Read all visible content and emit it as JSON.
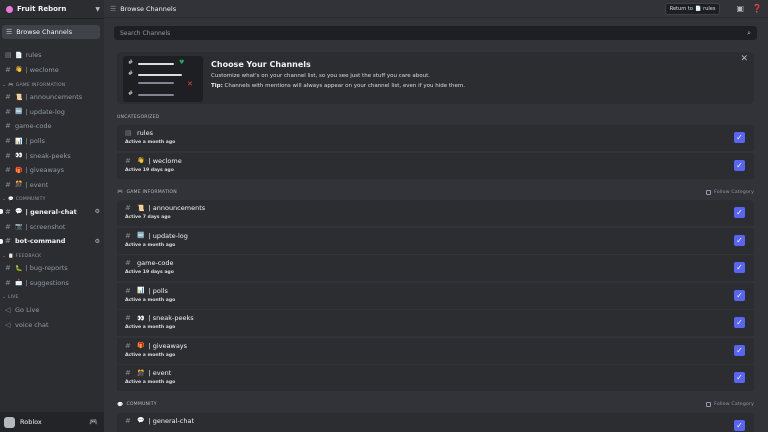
{
  "server": {
    "name": "Fruit Reborn"
  },
  "sidebar": {
    "browse_label": "Browse Channels",
    "channels": [
      {
        "label": "rules",
        "emoji": "📄",
        "type": "rules",
        "y": 0
      },
      {
        "label": "| weclome",
        "emoji": "👋",
        "type": "text",
        "y": 1
      }
    ],
    "categories": [
      {
        "title": "GAME INFORMATION",
        "emoji": "🎮",
        "channels": [
          {
            "label": "| announcements",
            "emoji": "📜"
          },
          {
            "label": "| update-log",
            "emoji": "🆕"
          },
          {
            "label": "game-code",
            "emoji": ""
          },
          {
            "label": "| polls",
            "emoji": "📊"
          },
          {
            "label": "| sneak-peeks",
            "emoji": "👀"
          },
          {
            "label": "| giveaways",
            "emoji": "🎁"
          },
          {
            "label": "| event",
            "emoji": "🎊"
          }
        ]
      },
      {
        "title": "COMMUNITY",
        "emoji": "💬",
        "channels": [
          {
            "label": "| general-chat",
            "emoji": "💬",
            "bold": true
          },
          {
            "label": "| screenshot",
            "emoji": "📷"
          },
          {
            "label": "bot-command",
            "emoji": "",
            "bold": true
          }
        ]
      },
      {
        "title": "FEEDBACK",
        "emoji": "📋",
        "channels": [
          {
            "label": "| bug-reports",
            "emoji": "🐛"
          },
          {
            "label": "| suggestions",
            "emoji": "📩"
          }
        ]
      },
      {
        "title": "LIVE",
        "emoji": "",
        "channels": [
          {
            "label": "Go Live",
            "emoji": ""
          },
          {
            "label": "voice chat",
            "emoji": ""
          }
        ]
      }
    ]
  },
  "user": {
    "name": "Roblox"
  },
  "topbar": {
    "title": "Browse Channels",
    "return_prefix": "Return to",
    "return_channel": "rules"
  },
  "search": {
    "placeholder": "Search Channels"
  },
  "banner": {
    "title": "Choose Your Channels",
    "line1": "Customize what's on your channel list, so you see just the stuff you care about.",
    "tip_label": "Tip:",
    "tip_text": "Channels with mentions will always appear on your channel list, even if you hide them."
  },
  "sections": [
    {
      "title": "UNCATEGORIZED",
      "emoji": "",
      "follow": "",
      "rows": [
        {
          "name": "rules",
          "emoji": "📄",
          "hash": "rules",
          "meta": "Active a month ago",
          "checked": true
        },
        {
          "name": "| weclome",
          "emoji": "👋",
          "hash": "#",
          "meta": "Active 19 days ago",
          "checked": true
        }
      ]
    },
    {
      "title": "GAME INFORMATION",
      "emoji": "🎮",
      "follow": "Follow Category",
      "rows": [
        {
          "name": "| announcements",
          "emoji": "📜",
          "hash": "#",
          "meta": "Active 7 days ago",
          "checked": true
        },
        {
          "name": "| update-log",
          "emoji": "🆕",
          "hash": "#",
          "meta": "Active a month ago",
          "checked": true
        },
        {
          "name": "game-code",
          "emoji": "",
          "hash": "#",
          "meta": "Active 19 days ago",
          "checked": true
        },
        {
          "name": "| polls",
          "emoji": "📊",
          "hash": "#",
          "meta": "Active a month ago",
          "checked": true
        },
        {
          "name": "| sneak-peeks",
          "emoji": "👀",
          "hash": "#",
          "meta": "Active a month ago",
          "checked": true
        },
        {
          "name": "| giveaways",
          "emoji": "🎁",
          "hash": "#",
          "meta": "Active a month ago",
          "checked": true
        },
        {
          "name": "| event",
          "emoji": "🎊",
          "hash": "#",
          "meta": "Active a month ago",
          "checked": true
        }
      ]
    },
    {
      "title": "COMMUNITY",
      "emoji": "💬",
      "follow": "Follow Category",
      "rows": [
        {
          "name": "| general-chat",
          "emoji": "💬",
          "hash": "#",
          "meta": "",
          "checked": true
        }
      ]
    }
  ]
}
